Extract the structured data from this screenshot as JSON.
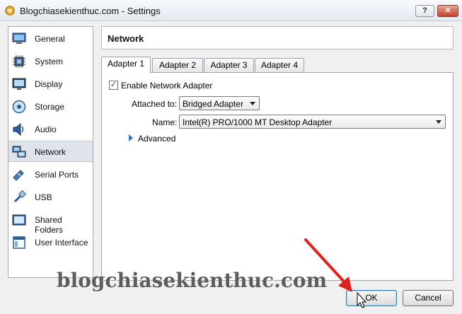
{
  "window": {
    "title": "Blogchiasekienthuc.com - Settings",
    "help_label": "?",
    "close_label": "✕"
  },
  "sidebar": {
    "items": [
      {
        "label": "General",
        "icon": "monitor-icon"
      },
      {
        "label": "System",
        "icon": "chip-icon"
      },
      {
        "label": "Display",
        "icon": "display-icon"
      },
      {
        "label": "Storage",
        "icon": "storage-icon"
      },
      {
        "label": "Audio",
        "icon": "speaker-icon"
      },
      {
        "label": "Network",
        "icon": "network-icon"
      },
      {
        "label": "Serial Ports",
        "icon": "serial-port-icon"
      },
      {
        "label": "USB",
        "icon": "usb-icon"
      },
      {
        "label": "Shared Folders",
        "icon": "folder-icon"
      },
      {
        "label": "User Interface",
        "icon": "user-interface-icon"
      }
    ],
    "selected": "Network"
  },
  "main": {
    "header_title": "Network",
    "tabs": [
      {
        "label": "Adapter 1"
      },
      {
        "label": "Adapter 2"
      },
      {
        "label": "Adapter 3"
      },
      {
        "label": "Adapter 4"
      }
    ],
    "active_tab": "Adapter 1",
    "enable_adapter": {
      "label": "Enable Network Adapter",
      "checked": true
    },
    "attached_to": {
      "label": "Attached to:",
      "value": "Bridged Adapter"
    },
    "name": {
      "label": "Name:",
      "value": "Intel(R) PRO/1000 MT Desktop Adapter"
    },
    "advanced_label": "Advanced"
  },
  "buttons": {
    "ok_label": "OK",
    "cancel_label": "Cancel"
  },
  "watermark": "blogchiasekienthuc.com",
  "colors": {
    "annotation_arrow": "#e0201b",
    "accent": "#2b78c5"
  }
}
